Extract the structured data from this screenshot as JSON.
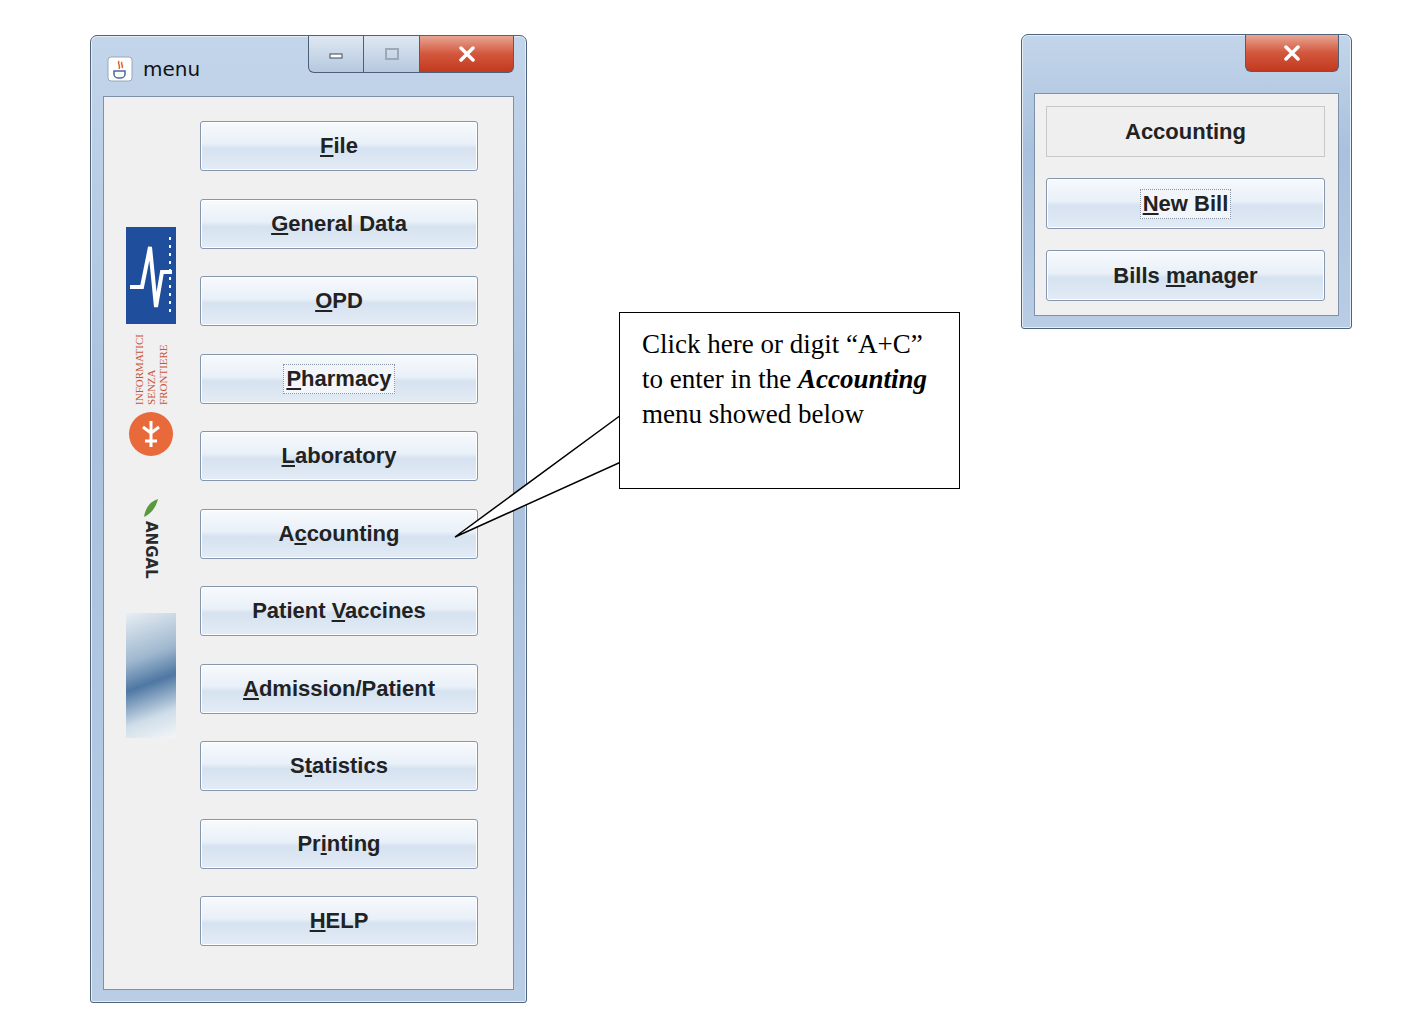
{
  "menu_window": {
    "title": "menu",
    "buttons": [
      {
        "label": "File",
        "mnemonic": 0,
        "focused": false
      },
      {
        "label": "General Data",
        "mnemonic": 0,
        "focused": false
      },
      {
        "label": "OPD",
        "mnemonic": 0,
        "focused": false
      },
      {
        "label": "Pharmacy",
        "mnemonic": 0,
        "focused": true
      },
      {
        "label": "Laboratory",
        "mnemonic": 0,
        "focused": false
      },
      {
        "label": "Accounting",
        "mnemonic": 1,
        "focused": false
      },
      {
        "label": "Patient Vaccines",
        "mnemonic": 8,
        "focused": false
      },
      {
        "label": "Admission/Patient",
        "mnemonic": 0,
        "focused": false
      },
      {
        "label": "Statistics",
        "mnemonic": 1,
        "focused": false
      },
      {
        "label": "Printing",
        "mnemonic": 2,
        "focused": false
      },
      {
        "label": "HELP",
        "mnemonic": 0,
        "focused": false
      }
    ]
  },
  "sidebar": {
    "isf_lines": [
      "INFORMATICI",
      "SENZA",
      "FRONTIERE"
    ],
    "angal": "ANGAL"
  },
  "callout": {
    "parts": [
      {
        "text": "Click here or digit “A+C” to enter in the ",
        "emphasis": false
      },
      {
        "text": "Accounting",
        "emphasis": true
      },
      {
        "text": " menu showed below",
        "emphasis": false
      }
    ]
  },
  "accounting_window": {
    "heading": "Accounting",
    "buttons": [
      {
        "label": "New Bill",
        "mnemonic": 0,
        "focused": true
      },
      {
        "label": "Bills manager",
        "mnemonic": 6,
        "focused": false
      }
    ]
  }
}
